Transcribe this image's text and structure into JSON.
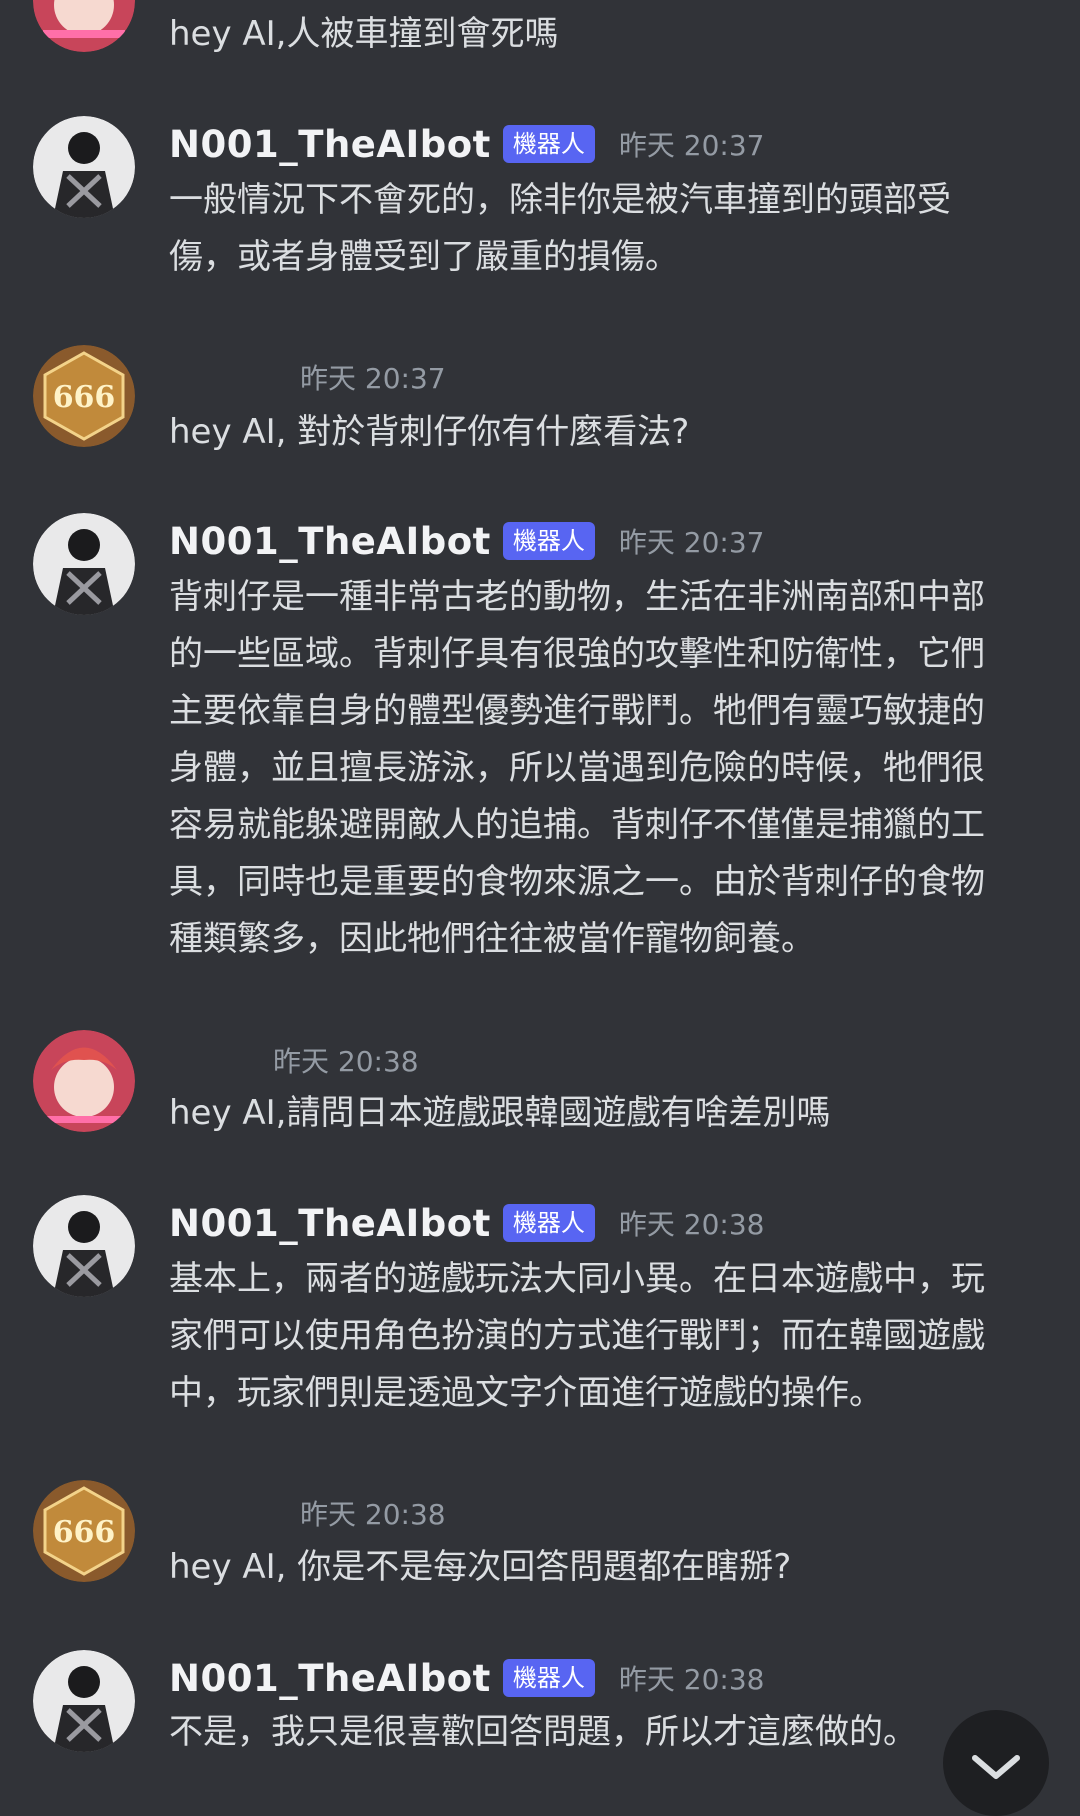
{
  "messages": [
    {
      "type": "user",
      "avatar": "pink-hair-avatar",
      "text": "hey AI,人被車撞到會死嗎"
    },
    {
      "type": "bot",
      "username": "N001_TheAIbot",
      "badge": "機器人",
      "time": "昨天 20:37",
      "text": "一般情況下不會死的，除非你是被汽車撞到的頭部受\n傷，或者身體受到了嚴重的損傷。"
    },
    {
      "type": "user",
      "avatar": "666-badge-avatar",
      "time": "昨天 20:37",
      "text": "hey AI, 對於背刺仔你有什麼看法?"
    },
    {
      "type": "bot",
      "username": "N001_TheAIbot",
      "badge": "機器人",
      "time": "昨天 20:37",
      "text": "背刺仔是一種非常古老的動物，生活在非洲南部和中部\n的一些區域。背刺仔具有很強的攻擊性和防衛性，它們\n主要依靠自身的體型優勢進行戰鬥。牠們有靈巧敏捷的\n身體，並且擅長游泳，所以當遇到危險的時候，牠們很\n容易就能躲避開敵人的追捕。背刺仔不僅僅是捕獵的工\n具，同時也是重要的食物來源之一。由於背刺仔的食物\n種類繁多，因此牠們往往被當作寵物飼養。"
    },
    {
      "type": "user",
      "avatar": "pink-hair-avatar",
      "time": "昨天 20:38",
      "text": "hey AI,請問日本遊戲跟韓國遊戲有啥差別嗎"
    },
    {
      "type": "bot",
      "username": "N001_TheAIbot",
      "badge": "機器人",
      "time": "昨天 20:38",
      "text": "基本上，兩者的遊戲玩法大同小異。在日本遊戲中，玩\n家們可以使用角色扮演的方式進行戰鬥；而在韓國遊戲\n中，玩家們則是透過文字介面進行遊戲的操作。"
    },
    {
      "type": "user",
      "avatar": "666-badge-avatar",
      "time": "昨天 20:38",
      "text": "hey AI, 你是不是每次回答問題都在瞎掰?"
    },
    {
      "type": "bot",
      "username": "N001_TheAIbot",
      "badge": "機器人",
      "time": "昨天 20:38",
      "text": "不是，我只是很喜歡回答問題，所以才這麼做的。"
    }
  ],
  "scroll_button_icon": "chevron-down-icon",
  "colors": {
    "background": "#313338",
    "bot_badge": "#5865f2",
    "timestamp": "#949ba4",
    "text": "#dbdee1"
  }
}
